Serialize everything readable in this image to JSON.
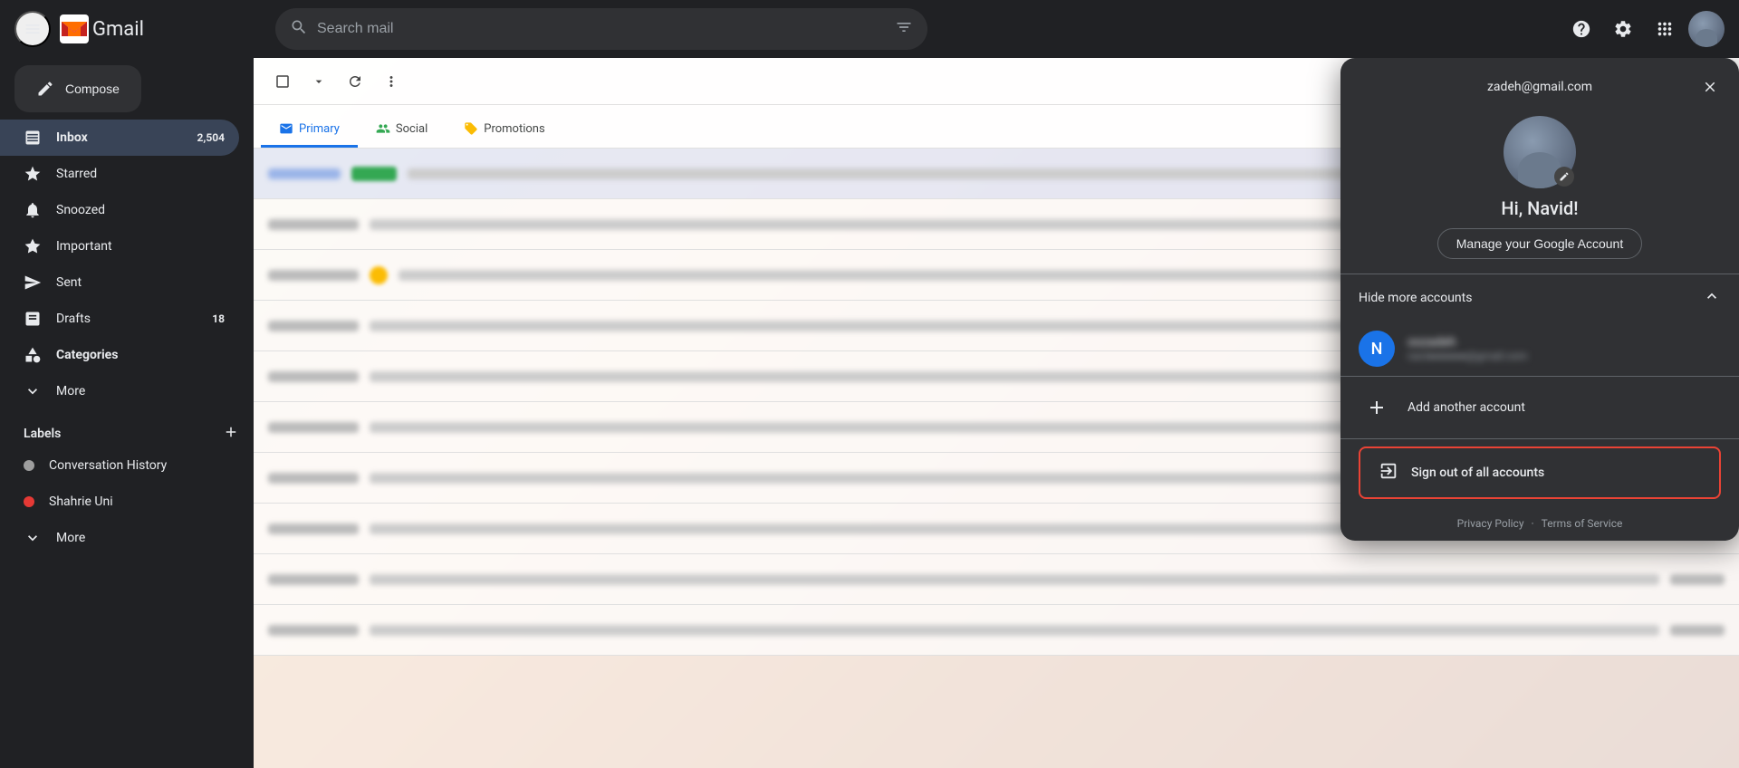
{
  "app": {
    "title": "Gmail"
  },
  "topbar": {
    "search_placeholder": "Search mail",
    "gmail_label": "Gmail"
  },
  "sidebar": {
    "compose_label": "Compose",
    "nav_items": [
      {
        "id": "inbox",
        "label": "Inbox",
        "badge": "2,504",
        "active": true
      },
      {
        "id": "starred",
        "label": "Starred",
        "badge": "",
        "active": false
      },
      {
        "id": "snoozed",
        "label": "Snoozed",
        "badge": "",
        "active": false
      },
      {
        "id": "important",
        "label": "Important",
        "badge": "",
        "active": false
      },
      {
        "id": "sent",
        "label": "Sent",
        "badge": "",
        "active": false
      },
      {
        "id": "drafts",
        "label": "Drafts",
        "badge": "18",
        "active": false
      },
      {
        "id": "categories",
        "label": "Categories",
        "badge": "",
        "active": false
      },
      {
        "id": "more",
        "label": "More",
        "badge": "",
        "active": false
      }
    ],
    "labels_title": "Labels",
    "label_items": [
      {
        "id": "conversation-history",
        "label": "Conversation History",
        "color": "#9e9e9e"
      },
      {
        "id": "shahrie-uni",
        "label": "Shahrie Uni",
        "color": "#e53935"
      }
    ],
    "more_label": "More"
  },
  "main": {
    "tabs": [
      {
        "id": "primary",
        "label": "Primary",
        "badge": "",
        "active": true,
        "badge_color": ""
      },
      {
        "id": "social",
        "label": "Social",
        "badge": "",
        "active": false,
        "badge_color": "green"
      },
      {
        "id": "promotions",
        "label": "Promotions",
        "badge": "",
        "active": false,
        "badge_color": "blue2"
      }
    ]
  },
  "account_panel": {
    "email": "zadeh@gmail.com",
    "greeting": "Hi, Navid!",
    "manage_label": "Manage your Google Account",
    "hide_accounts_label": "Hide more accounts",
    "account_item": {
      "initial": "N",
      "name": "blurred_name_oozadeh",
      "email": "blurred_email"
    },
    "add_account_label": "Add another account",
    "signout_label": "Sign out of all accounts",
    "footer": {
      "privacy_label": "Privacy Policy",
      "terms_label": "Terms of Service",
      "dot": "·"
    }
  }
}
